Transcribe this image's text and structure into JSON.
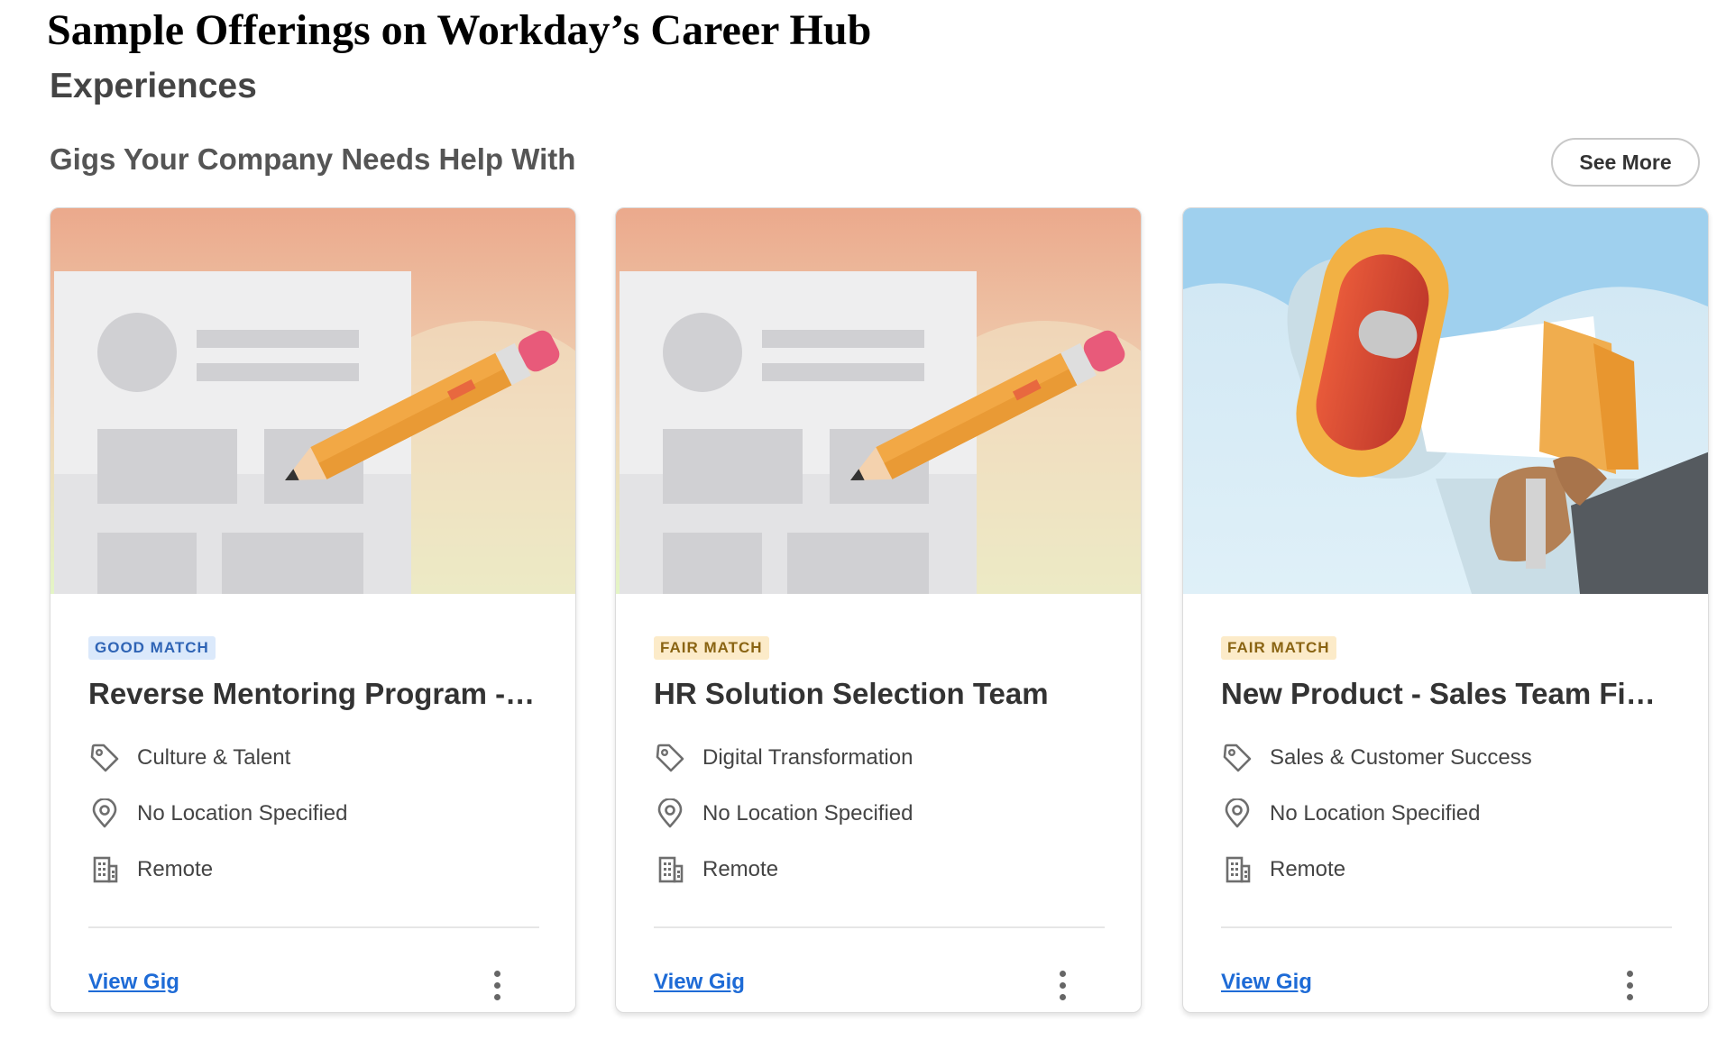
{
  "caption": "Sample Offerings on Workday’s Career Hub",
  "section_title": "Experiences",
  "row_title": "Gigs Your Company Needs Help With",
  "see_more_label": "See More",
  "colors": {
    "good_match_bg": "#dbe9fb",
    "good_match_text": "#2f64b5",
    "fair_match_bg": "#fcebc9",
    "fair_match_text": "#8a6413",
    "link": "#1e6bd6"
  },
  "cards": [
    {
      "illustration": "document-pencil",
      "badge": "GOOD MATCH",
      "badge_type": "good",
      "title": "Reverse Mentoring Program - Reverse Mentoring Program",
      "category": "Culture & Talent",
      "category_icon": "tag-icon",
      "location": "No Location Specified",
      "location_icon": "location-pin-icon",
      "work_type": "Remote",
      "work_type_icon": "building-icon",
      "link": "View Gig"
    },
    {
      "illustration": "document-pencil",
      "badge": "FAIR MATCH",
      "badge_type": "fair",
      "title": "HR Solution Selection Team",
      "category": "Digital Transformation",
      "category_icon": "tag-icon",
      "location": "No Location Specified",
      "location_icon": "location-pin-icon",
      "work_type": "Remote",
      "work_type_icon": "building-icon",
      "link": "View Gig"
    },
    {
      "illustration": "megaphone",
      "badge": "FAIR MATCH",
      "badge_type": "fair",
      "title": "New Product - Sales Team Field Enablement",
      "category": "Sales & Customer Success",
      "category_icon": "tag-icon",
      "location": "No Location Specified",
      "location_icon": "location-pin-icon",
      "work_type": "Remote",
      "work_type_icon": "building-icon",
      "link": "View Gig"
    }
  ]
}
